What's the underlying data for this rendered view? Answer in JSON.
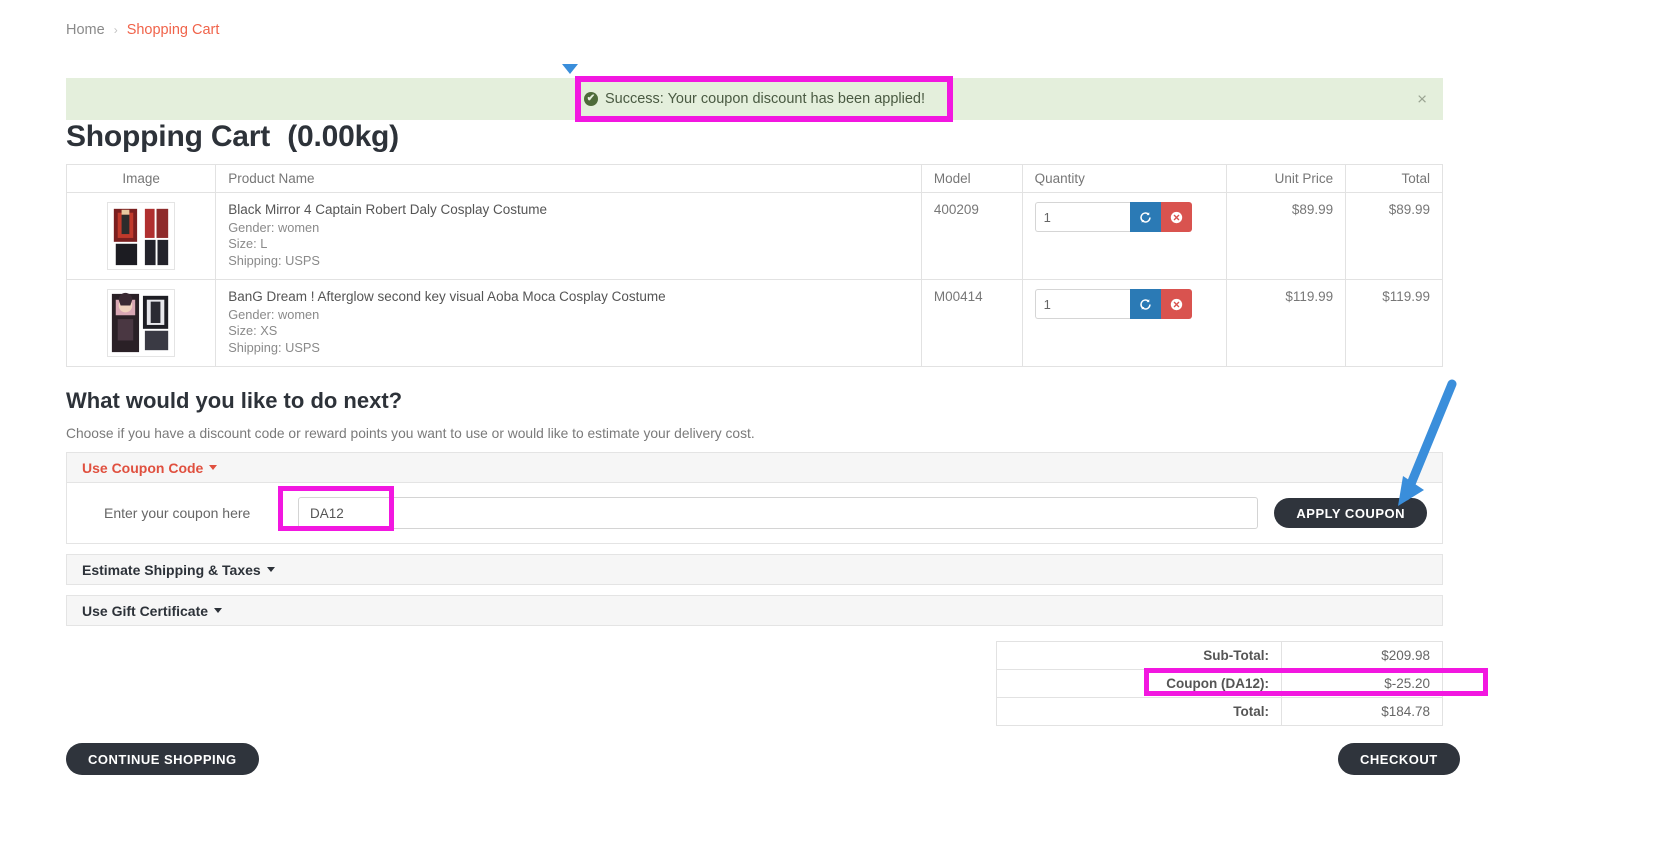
{
  "breadcrumb": {
    "home": "Home",
    "separator": "›",
    "current": "Shopping Cart"
  },
  "alert": {
    "message": "Success: Your coupon discount has been applied!",
    "close_label": "×",
    "check_glyph": "✔",
    "bg_color": "#e4efdc"
  },
  "page_title": {
    "main": "Shopping Cart",
    "weight": "(0.00kg)"
  },
  "cart_table": {
    "headers": [
      "Image",
      "Product Name",
      "Model",
      "Quantity",
      "Unit Price",
      "Total"
    ],
    "rows": [
      {
        "name": "Black Mirror 4 Captain Robert Daly Cosplay Costume",
        "gender": "Gender: women",
        "size": "Size: L",
        "shipping": "Shipping: USPS",
        "model": "400209",
        "quantity": "1",
        "unit_price": "$89.99",
        "total": "$89.99",
        "refresh_icon": "refresh-icon",
        "remove_icon": "remove-icon"
      },
      {
        "name": "BanG Dream ! Afterglow second key visual Aoba Moca Cosplay Costume",
        "gender": "Gender: women",
        "size": "Size: XS",
        "shipping": "Shipping: USPS",
        "model": "M00414",
        "quantity": "1",
        "unit_price": "$119.99",
        "total": "$119.99",
        "refresh_icon": "refresh-icon",
        "remove_icon": "remove-icon"
      }
    ]
  },
  "next_section": {
    "title": "What would you like to do next?",
    "subtitle": "Choose if you have a discount code or reward points you want to use or would like to estimate your delivery cost."
  },
  "accordion": {
    "coupon": {
      "header": "Use Coupon Code",
      "field_label": "Enter your coupon here",
      "value": "DA12",
      "placeholder": "Enter your coupon here",
      "apply_label": "APPLY COUPON"
    },
    "shipping": {
      "header": "Estimate Shipping & Taxes"
    },
    "gift": {
      "header": "Use Gift Certificate"
    }
  },
  "totals": {
    "rows": [
      {
        "label": "Sub-Total:",
        "value": "$209.98"
      },
      {
        "label": "Coupon (DA12):",
        "value": "$-25.20"
      },
      {
        "label": "Total:",
        "value": "$184.78"
      }
    ]
  },
  "footer": {
    "continue_label": "CONTINUE SHOPPING",
    "checkout_label": "CHECKOUT"
  },
  "annotations": {
    "highlight_color": "#f217e0",
    "cursor_color": "#3a8edb"
  }
}
